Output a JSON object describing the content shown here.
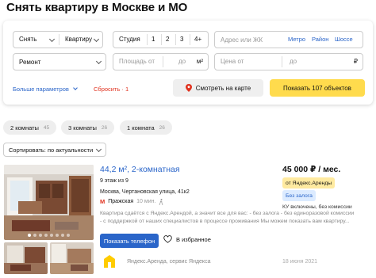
{
  "page": {
    "title": "Снять квартиру в Москве и МО"
  },
  "filters": {
    "deal_type": "Снять",
    "property_type": "Квартиру",
    "rooms": [
      "Студия",
      "1",
      "2",
      "3",
      "4+"
    ],
    "address_placeholder": "Адрес или ЖК",
    "search_by": [
      "Метро",
      "Район",
      "Шоссе"
    ],
    "renovation": "Ремонт",
    "area_from": "Площадь от",
    "area_to": "до",
    "area_unit": "м²",
    "price_from": "Цена от",
    "price_to": "до",
    "price_unit": "₽",
    "more_params": "Больше параметров",
    "reset": "Сбросить · 1",
    "show_on_map": "Смотреть на карте",
    "show_results": "Показать 107 объектов"
  },
  "quick_filters": [
    {
      "label": "2 комнаты",
      "count": "45"
    },
    {
      "label": "3 комнаты",
      "count": "26"
    },
    {
      "label": "1 комната",
      "count": "26"
    }
  ],
  "sort": {
    "label": "Сортировать: по актуальности"
  },
  "listing": {
    "title": "44,2 м², 2-комнатная",
    "floor": "9 этаж из 9",
    "address": "Москва, Чертановская улица, 41к2",
    "metro_icon": "М",
    "metro": "Пражская",
    "walk": "10 мин.",
    "description_1": "Квартира сдаётся с Яндекс.Арендой, а значит все для вас: - без залога - без единоразовой комиссии",
    "description_2": "- с поддержкой от наших специалистов в процессе проживания Мы можем показать вам квартиру...",
    "phone_button": "Показать телефон",
    "favorite": "В избранное",
    "price": "45 000 ₽ / мес.",
    "badge_ya": "от Яндекс.Аренды",
    "badge_deposit": "Без залога",
    "price_note": "КУ включены, без комиссии",
    "agent": "Яндекс.Аренда, сервис Яндекса",
    "date": "18 июня 2021"
  },
  "colors": {
    "accent_blue": "#2a65c9",
    "brand_yellow": "#ffdb4d",
    "reset_red": "#e0311e"
  }
}
